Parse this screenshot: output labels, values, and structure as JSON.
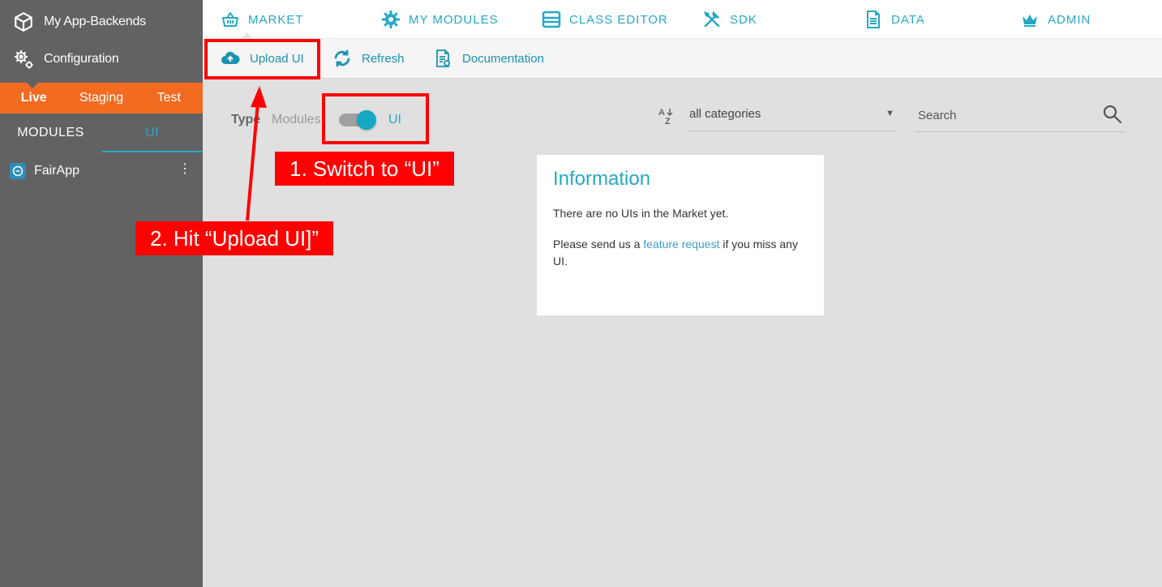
{
  "sidebar": {
    "app_backends_label": "My App-Backends",
    "configuration_label": "Configuration",
    "environments": [
      "Live",
      "Staging",
      "Test"
    ],
    "tabs": {
      "modules": "MODULES",
      "ui": "UI"
    },
    "app_name": "FairApp",
    "kebab": "⋮"
  },
  "topnav": {
    "market": "MARKET",
    "my_modules": "MY MODULES",
    "class_editor": "CLASS EDITOR",
    "sdk": "SDK",
    "data": "DATA",
    "admin": "ADMIN"
  },
  "toolbar": {
    "upload": "Upload UI",
    "refresh": "Refresh",
    "documentation": "Documentation"
  },
  "filter": {
    "type_label": "Type",
    "modules_label": "Modules",
    "ui_label": "UI",
    "category_value": "all categories",
    "category_arrow": "▼",
    "search_placeholder": "Search"
  },
  "info": {
    "title": "Information",
    "line1": "There are no UIs in the Market yet.",
    "line2_pre": "Please send us a ",
    "line2_link": "feature request",
    "line2_post": " if you miss any UI."
  },
  "annotations": {
    "step1": "1. Switch to “UI”",
    "step2": "2. Hit “Upload UI]”"
  },
  "colors": {
    "accent": "#26a9c4",
    "env_bar": "#f26b21",
    "sidebar_bg": "#626262",
    "annotation": "#ff0000"
  }
}
